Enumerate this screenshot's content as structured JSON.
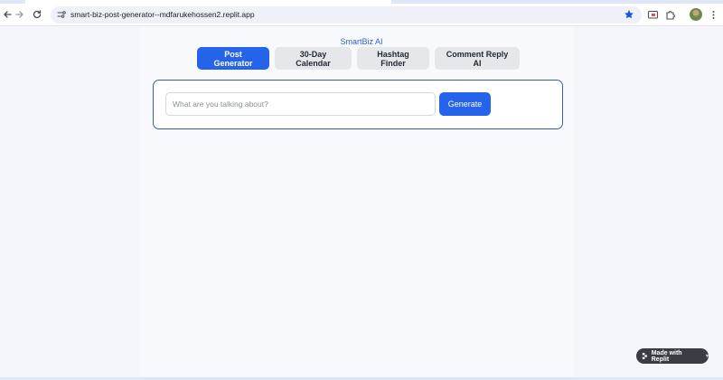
{
  "browser": {
    "url": "smart-biz-post-generator--mdfarukehossen2.replit.app"
  },
  "app": {
    "brand": "SmartBiz AI",
    "tabs": [
      {
        "label": "Post Generator",
        "active": true
      },
      {
        "label": "30-Day Calendar",
        "active": false
      },
      {
        "label": "Hashtag Finder",
        "active": false
      },
      {
        "label": "Comment Reply AI",
        "active": false
      }
    ],
    "input": {
      "value": "",
      "placeholder": "What are you talking about?"
    },
    "generate_label": "Generate",
    "badge_label": "Made with Replit"
  },
  "colors": {
    "accent": "#2563eb",
    "card_border": "#3b5bab",
    "brand_text": "#2f5fc4"
  },
  "icons": [
    "back-arrow-icon",
    "forward-arrow-icon",
    "reload-icon",
    "site-info-icon",
    "star-icon",
    "cast-icon",
    "extensions-icon",
    "more-icon",
    "replit-logo-icon"
  ]
}
